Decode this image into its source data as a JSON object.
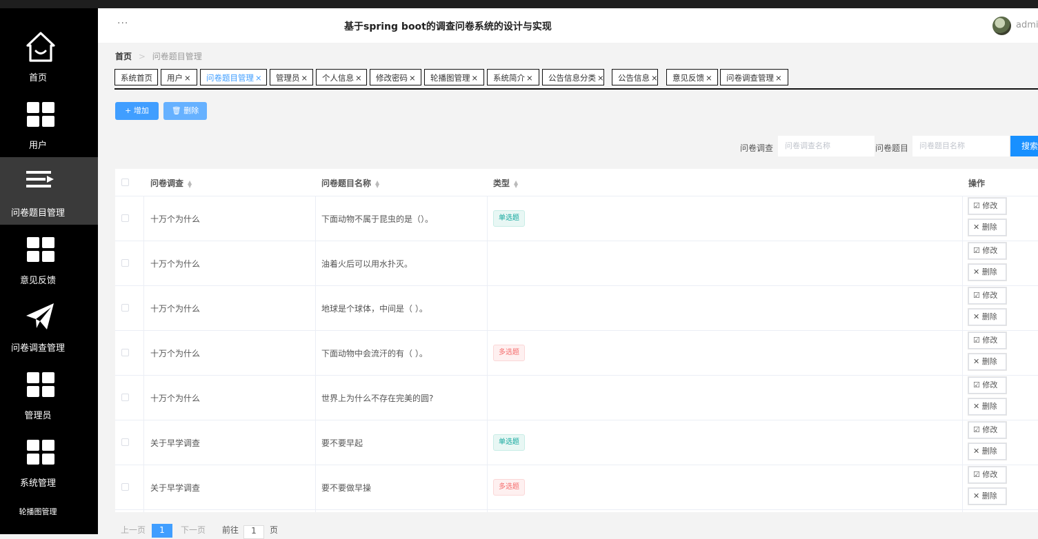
{
  "header": {
    "title": "基于spring boot的调查问卷系统的设计与实现",
    "user": "admin",
    "menu_dots": "···"
  },
  "sidebar": {
    "items": [
      {
        "label": "首页",
        "icon": "home-icon"
      },
      {
        "label": "用户",
        "icon": "grid-icon"
      },
      {
        "label": "问卷题目管理",
        "icon": "menu-lines-icon"
      },
      {
        "label": "意见反馈",
        "icon": "grid-icon"
      },
      {
        "label": "问卷调查管理",
        "icon": "paper-plane-icon"
      },
      {
        "label": "管理员",
        "icon": "grid-icon"
      },
      {
        "label": "系统管理",
        "icon": "grid-icon"
      }
    ],
    "sub_label": "轮播图管理"
  },
  "breadcrumb": {
    "home": "首页",
    "separator": ">",
    "current": "问卷题目管理"
  },
  "tabs": [
    {
      "label": "系统首页",
      "closable": false
    },
    {
      "label": "用户",
      "closable": true
    },
    {
      "label": "问卷题目管理",
      "closable": true,
      "active": true
    },
    {
      "label": "管理员",
      "closable": true
    },
    {
      "label": "个人信息",
      "closable": true
    },
    {
      "label": "修改密码",
      "closable": true
    },
    {
      "label": "轮播图管理",
      "closable": true
    },
    {
      "label": "系统简介",
      "closable": true
    },
    {
      "label": "公告信息分类",
      "closable": true
    },
    {
      "label": "公告信息",
      "closable": true
    },
    {
      "label": "意见反馈",
      "closable": true
    },
    {
      "label": "问卷调查管理",
      "closable": true
    }
  ],
  "toolbar": {
    "add_label": "+ 增加",
    "delete_label": "🗑 删除"
  },
  "search": {
    "survey_label": "问卷调查",
    "survey_placeholder": "问卷调查名称",
    "question_label": "问卷题目",
    "question_placeholder": "问卷题目名称",
    "button": "搜索"
  },
  "table": {
    "columns": [
      "问卷调查",
      "问卷题目名称",
      "类型",
      "操作"
    ],
    "rows": [
      {
        "survey": "十万个为什么",
        "question": "下面动物不属于昆虫的是（）。",
        "type": "单选题"
      },
      {
        "survey": "十万个为什么",
        "question": "油着火后可以用水扑灭。",
        "type": ""
      },
      {
        "survey": "十万个为什么",
        "question": "地球是个球体，中间是（ ）。",
        "type": ""
      },
      {
        "survey": "十万个为什么",
        "question": "下面动物中会流汗的有（ ）。",
        "type": "多选题"
      },
      {
        "survey": "十万个为什么",
        "question": "世界上为什么不存在完美的圆?",
        "type": ""
      },
      {
        "survey": "关于早学调查",
        "question": "要不要早起",
        "type": "单选题"
      },
      {
        "survey": "关于早学调查",
        "question": "要不要做早操",
        "type": "多选题"
      }
    ],
    "edit_label": "☑ 修改",
    "delete_label": "✕ 删除"
  },
  "pagination": {
    "prev": "上一页",
    "current": "1",
    "next": "下一页",
    "goto_prefix": "前往",
    "goto_value": "1",
    "goto_suffix": "页"
  },
  "colors": {
    "primary": "#409eff",
    "sidebar_bg": "#000000",
    "single_tag": "#13a89e",
    "multi_tag": "#f56c6c"
  }
}
